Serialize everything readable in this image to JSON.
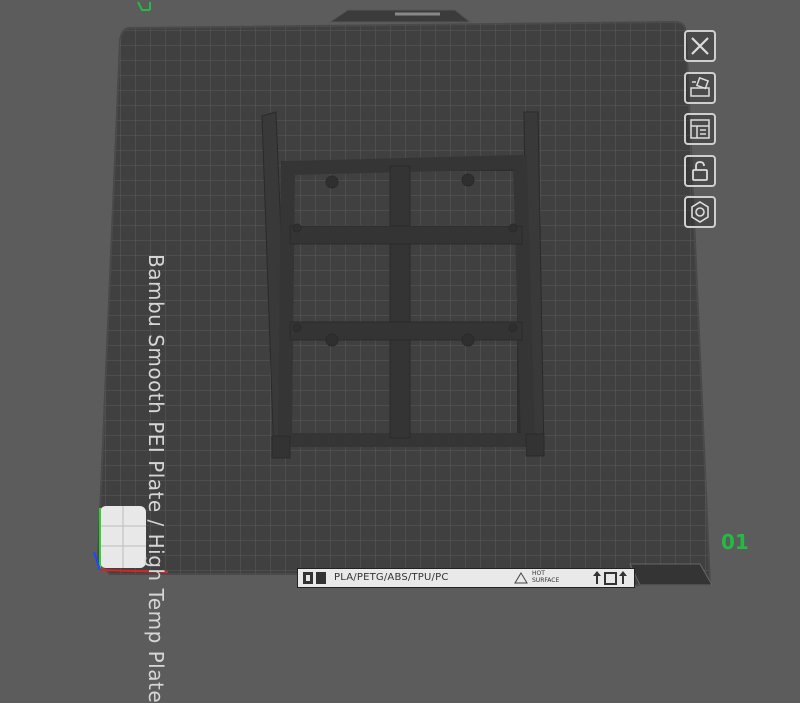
{
  "plate": {
    "label": "Bambu Smooth PEI Plate / High Temp Plate",
    "number": "01",
    "materials": "PLA/PETG/ABS/TPU/PC",
    "hot_surface_line1": "HOT",
    "hot_surface_line2": "SURFACE"
  },
  "toolbar": [
    {
      "icon": "close-icon"
    },
    {
      "icon": "arrange-icon"
    },
    {
      "icon": "orient-icon"
    },
    {
      "icon": "lock-icon"
    },
    {
      "icon": "settings-icon"
    }
  ],
  "colors": {
    "background": "#5c5c5c",
    "plate": "#3f3f3f",
    "grid": "#585858",
    "accent_green": "#22bb44"
  }
}
